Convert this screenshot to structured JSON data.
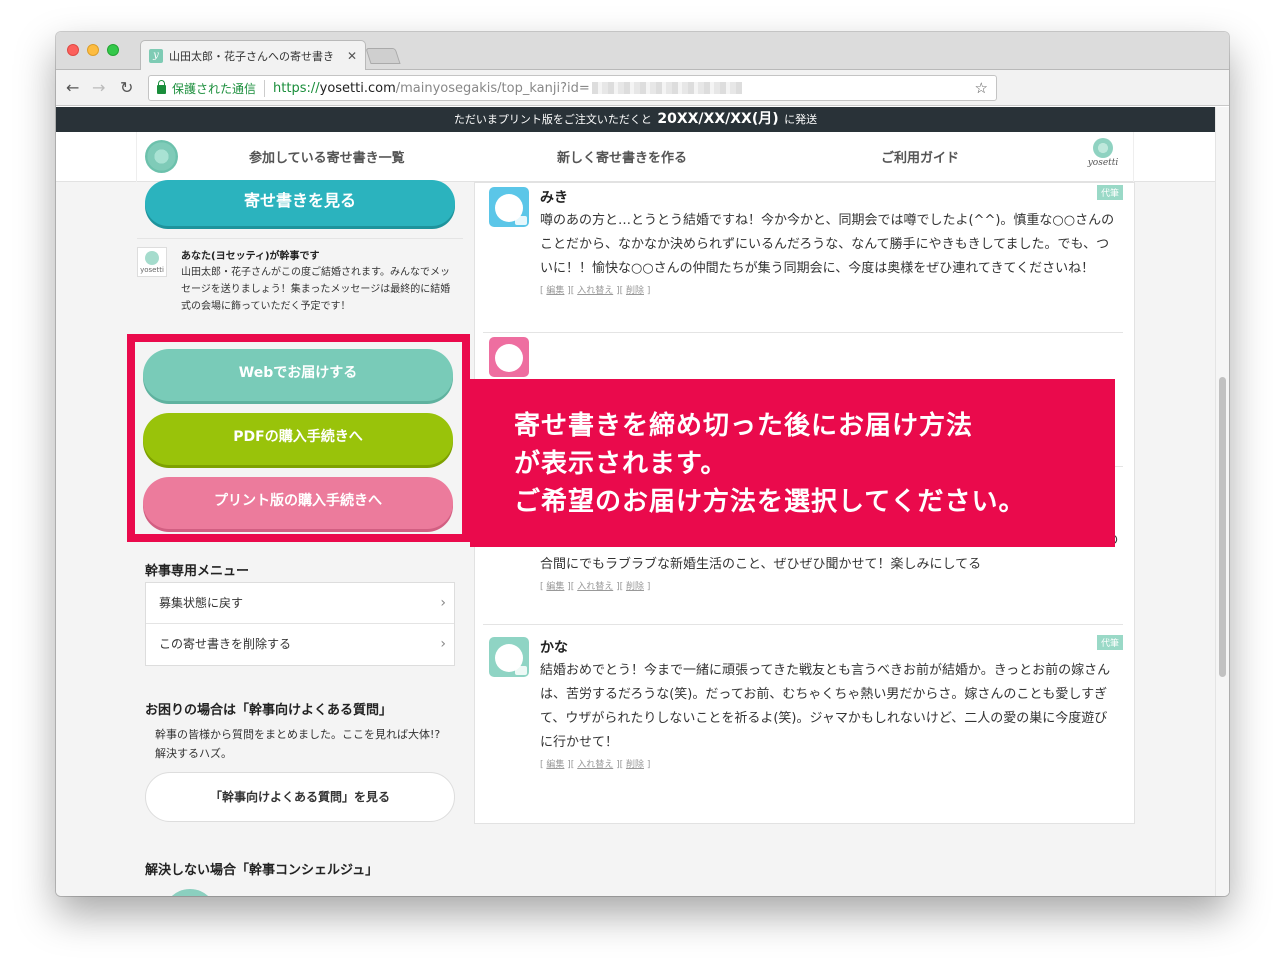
{
  "browser": {
    "tab_title": "山田太郎・花子さんへの寄せ書き",
    "tab_close": "✕",
    "nav_back": "←",
    "nav_forward": "→",
    "nav_reload": "↻",
    "secure_label": "保護された通信",
    "url_scheme": "https://",
    "url_host": "yosetti.com",
    "url_path": "/mainyosegakis/top_kanji?id=",
    "star": "☆"
  },
  "notice": {
    "prefix": "ただいまプリント版をご注文いただくと",
    "date": "20XX/XX/XX(月)",
    "suffix": "に発送"
  },
  "site_nav": {
    "items": [
      "参加している寄せ書き一覧",
      "新しく寄せ書きを作る",
      "ご利用ガイド"
    ],
    "brand": "yosetti"
  },
  "sidebar": {
    "view_button": "寄せ書きを見る",
    "owner": {
      "avatar_label": "yosetti",
      "title": "あなた(ヨセッティ)が幹事です",
      "text": "山田太郎・花子さんがこの度ご結婚されます。みんなでメッセージを送りましょう！集まったメッセージは最終的に結婚式の会場に飾っていただく予定です！"
    },
    "delivery": {
      "web": "Webでお届けする",
      "pdf": "PDFの購入手続きへ",
      "print": "プリント版の購入手続きへ"
    },
    "menu_title": "幹事専用メニュー",
    "menu_items": [
      "募集状態に戻す",
      "この寄せ書きを削除する"
    ],
    "help_title": "お困りの場合は「幹事向けよくある質問」",
    "help_text": "幹事の皆様から質問をまとめました。ここを見れば大体!?解決するハズ。",
    "faq_button": "「幹事向けよくある質問」を見る",
    "concierge_title": "解決しない場合「幹事コンシェルジュ」"
  },
  "messages": [
    {
      "name": "みき",
      "badge": "代筆",
      "body": "噂のあの方と…とうとう結婚ですね！今か今かと、同期会では噂でしたよ(^^)。慎重な○○さんのことだから、なかなか決められずにいるんだろうな、なんて勝手にやきもきしてました。でも、ついに！！愉快な○○さんの仲間たちが集う同期会に、今度は奥様をぜひ連れてきてくださいね！"
    },
    {
      "name": "",
      "badge": "",
      "body": ""
    },
    {
      "name": "",
      "badge": "",
      "body": "いつも一緒に頑張ってきた○○ちゃん、結婚おめでとう。仕事のライバルだったときもあったね(^^;)。でも、○○ちゃんは、赤い糸で結ばれた運命の人と出会ったんだね。羨ましいよ〜！仕事の合間にでもラブラブな新婚生活のこと、ぜひぜひ聞かせて！楽しみにしてる"
    },
    {
      "name": "かな",
      "badge": "代筆",
      "body": "結婚おめでとう！今まで一緒に頑張ってきた戦友とも言うべきお前が結婚か。きっとお前の嫁さんは、苦労するだろうな(笑)。だってお前、むちゃくちゃ熱い男だからさ。嫁さんのことも愛しすぎて、ウザがられたりしないことを祈るよ(笑)。ジャマかもしれないけど、二人の愛の巣に今度遊びに行かせて！"
    }
  ],
  "message_actions": {
    "open": "[",
    "sep": "][",
    "close": "]",
    "edit": "編集",
    "swap": "入れ替え",
    "delete": "削除"
  },
  "callout": {
    "lines": [
      "寄せ書きを締め切った後にお届け方法",
      "が表示されます。",
      "ご希望のお届け方法を選択してください。"
    ]
  }
}
